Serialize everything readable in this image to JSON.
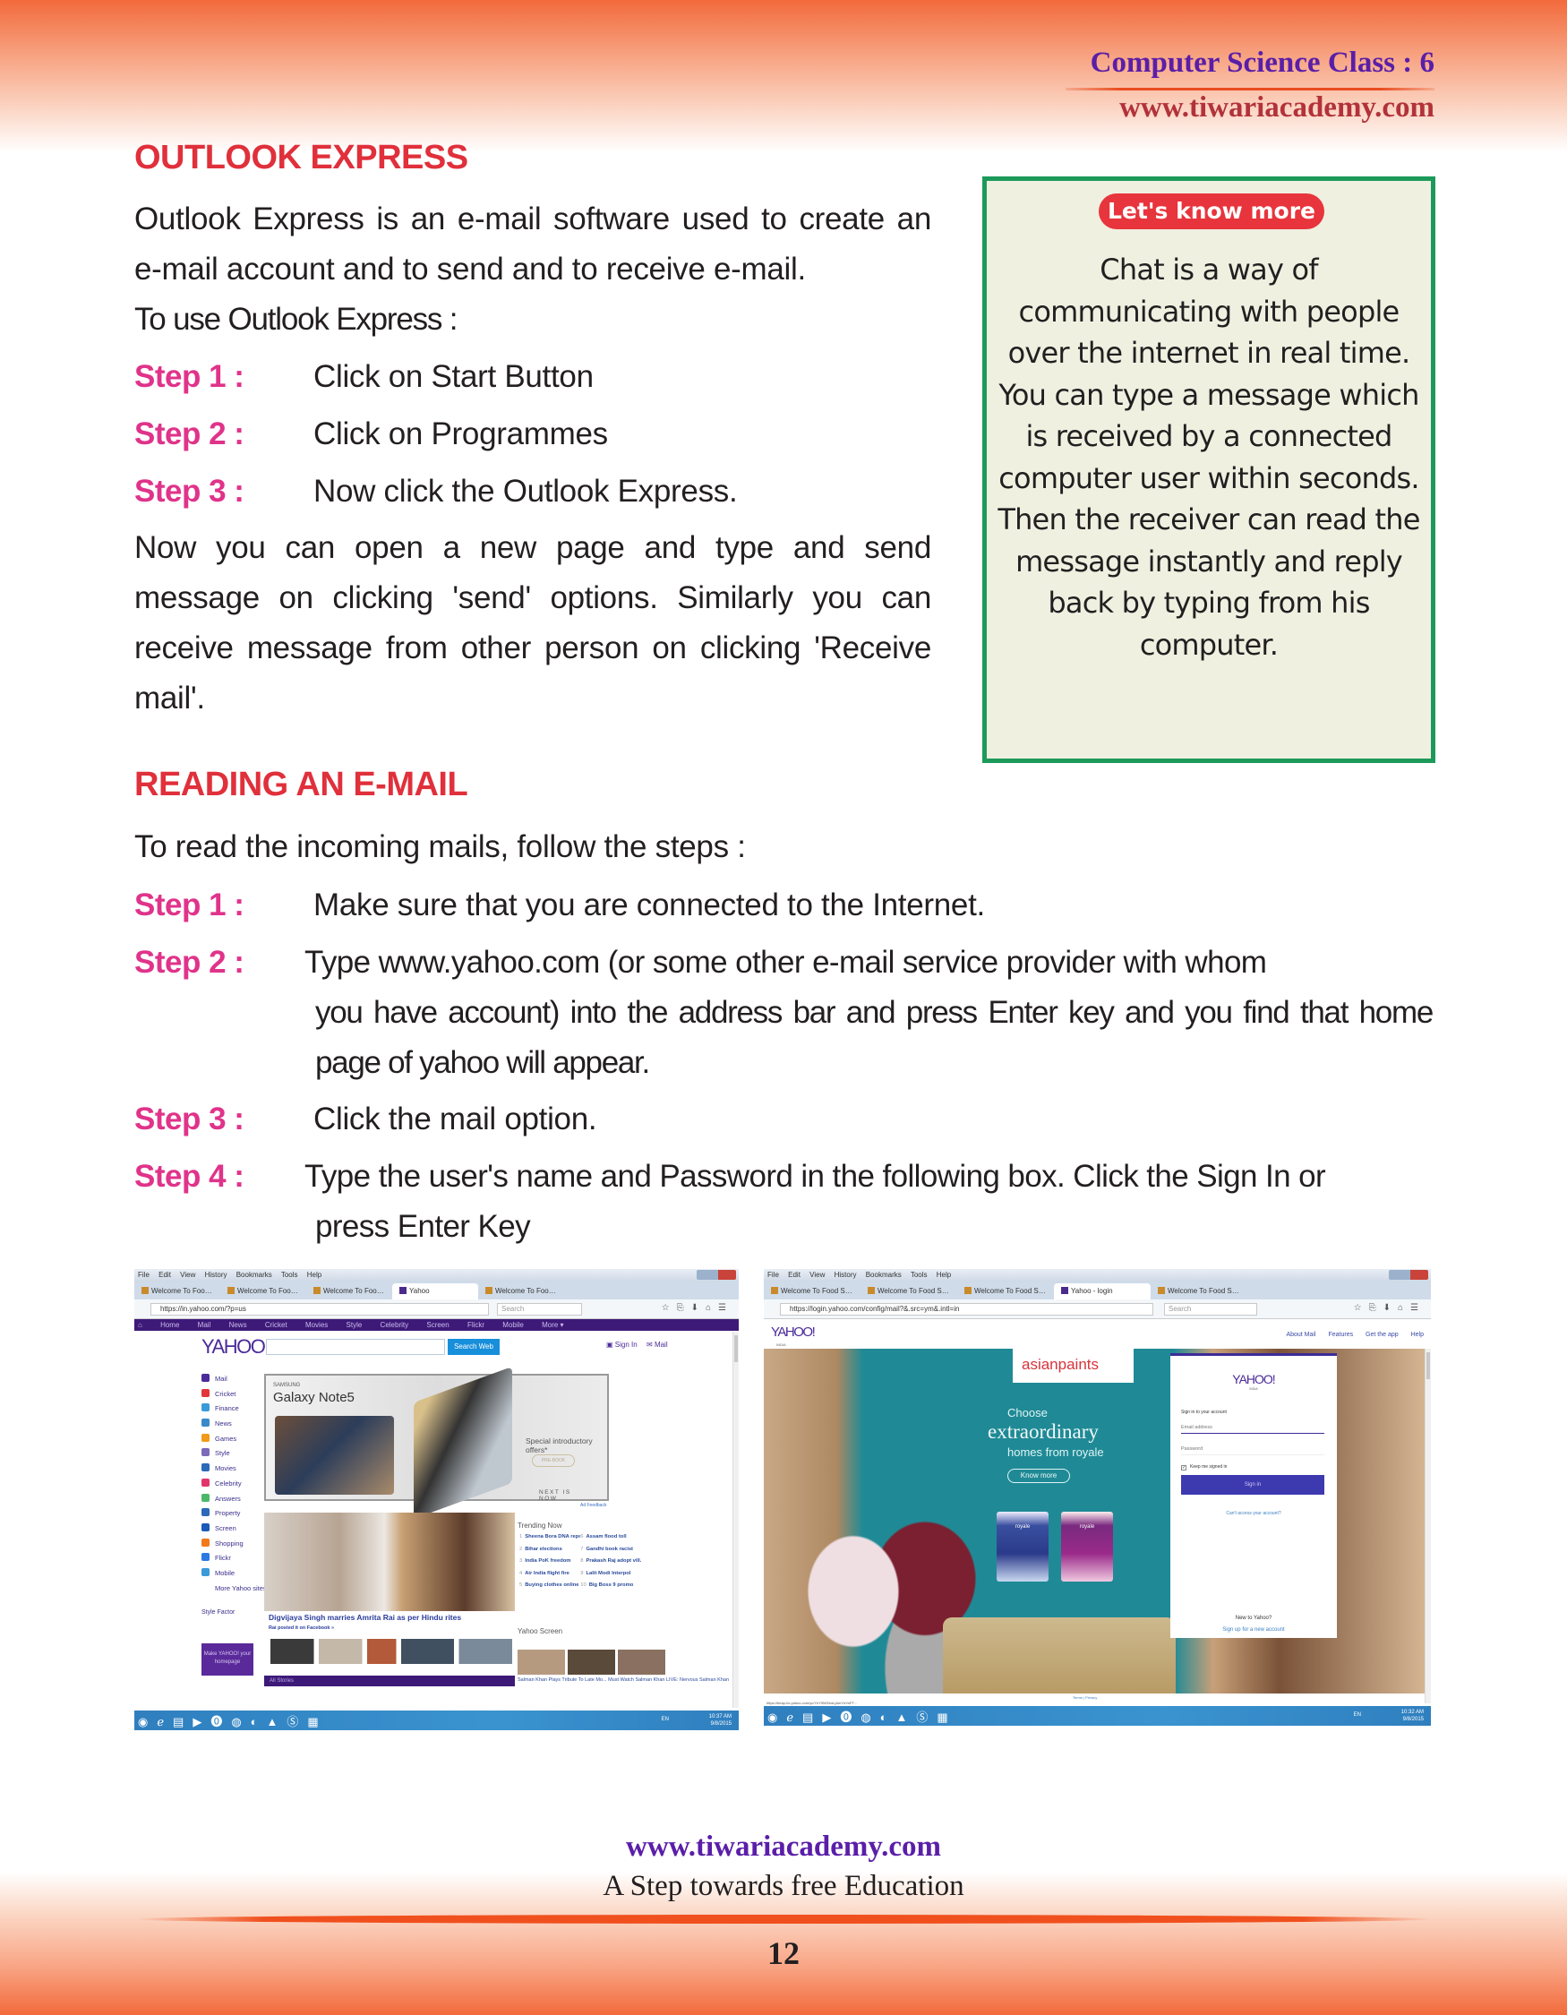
{
  "header": {
    "title": "Computer Science Class : 6",
    "url": "www.tiwariacademy.com"
  },
  "section1": {
    "heading": "OUTLOOK EXPRESS",
    "intro": "Outlook Express is an e-mail software used to create an e-mail account and to send and to receive e-mail.",
    "intro2": "To use Outlook Express :",
    "steps": [
      {
        "label": "Step 1 :",
        "text": "Click on Start Button"
      },
      {
        "label": "Step 2 :",
        "text": "Click on Programmes"
      },
      {
        "label": "Step 3 :",
        "text": "Now click the Outlook Express."
      }
    ],
    "outro": "Now you can open a new page and type and send message on clicking 'send' options. Similarly you can receive message from other person on clicking 'Receive mail'."
  },
  "know_more": {
    "badge": "Let's know more",
    "text": "Chat is a way of communicating with people over the internet in real time. You can type a message which is received by a connected computer user within seconds. Then the receiver can read the message instantly and reply back by typing from his computer."
  },
  "section2": {
    "heading": "READING AN E-MAIL",
    "intro": "To read the incoming mails, follow the steps :",
    "steps": [
      {
        "label": "Step 1 :",
        "text": "Make sure that you are connected to the Internet."
      },
      {
        "label": "Step 2 :",
        "text": "Type www.yahoo.com (or some other e-mail service provider with whom",
        "cont": "you have account) into the address bar and press Enter key and you find that home page of yahoo will appear."
      },
      {
        "label": "Step 3 :",
        "text": "Click the mail option."
      },
      {
        "label": "Step 4 :",
        "text": "Type the user's name and Password in the following box. Click the Sign In or",
        "cont": "press Enter Key"
      }
    ]
  },
  "screenshot_home": {
    "menu": [
      "File",
      "Edit",
      "View",
      "History",
      "Bookmarks",
      "Tools",
      "Help"
    ],
    "tabs": [
      "Welcome To Food Security...",
      "Welcome To Food Security...",
      "Welcome To Food Security...",
      "Yahoo",
      "Welcome To Food Security..."
    ],
    "active_tab": "Yahoo",
    "url": "https://in.yahoo.com/?p=us",
    "search_placeholder": "Search",
    "nav": [
      "Home",
      "Mail",
      "News",
      "Cricket",
      "Movies",
      "Style",
      "Celebrity",
      "Screen",
      "Flickr",
      "Mobile",
      "More ▾"
    ],
    "logo": "YAHOO!",
    "search_button": "Search Web",
    "sign_in": "Sign In",
    "mail": "Mail",
    "sidebar": [
      {
        "label": "Mail",
        "color": "#4b2a9a"
      },
      {
        "label": "Cricket",
        "color": "#e2363a"
      },
      {
        "label": "Finance",
        "color": "#3a9ad9"
      },
      {
        "label": "News",
        "color": "#3a8ac9"
      },
      {
        "label": "Games",
        "color": "#f29a1a"
      },
      {
        "label": "Style",
        "color": "#7a6ab8"
      },
      {
        "label": "Movies",
        "color": "#2a6ab8"
      },
      {
        "label": "Celebrity",
        "color": "#e2366a"
      },
      {
        "label": "Answers",
        "color": "#4ab86a"
      },
      {
        "label": "Property",
        "color": "#2a6ab8"
      },
      {
        "label": "Screen",
        "color": "#1a5ab8"
      },
      {
        "label": "Shopping",
        "color": "#f27a1a"
      },
      {
        "label": "Flickr",
        "color": "#2a7ae2"
      },
      {
        "label": "Mobile",
        "color": "#3a9ad9"
      },
      {
        "label": "More Yahoo sites »",
        "color": "#ffffff"
      }
    ],
    "style_factor": "Style Factor",
    "make_yahoo": "Make YAHOO! your homepage",
    "ad": {
      "brand": "SAMSUNG",
      "title": "Galaxy Note5",
      "offer": "Special introductory offers*",
      "cta": "PRE-BOOK",
      "tagline": "NEXT IS NOW",
      "feedback": "Ad Feedback"
    },
    "news_headline": "Digvijaya Singh marries Amrita Rai as per Hindu rites",
    "news_link": "Rai posted it on Facebook »",
    "trending_title": "Trending Now",
    "trending": [
      "Sheena Bora DNA report",
      "Bihar elections",
      "India PoK freedom",
      "Air India flight fire",
      "Buying clothes online",
      "Assam flood toll",
      "Gandhi book racist",
      "Prakash Raj adopt vill...",
      "Lalit Modi Interpol",
      "Big Boss 9 promo"
    ],
    "yahoo_screen_title": "Yahoo Screen",
    "yahoo_screen_captions": "Salman Khan Plays Tribute To Late Mo...   Must Watch Salman Khan   LIVE: Nervous Salman Khan",
    "all_stories": "All Stories",
    "language": "EN",
    "time": "10:37 AM",
    "date": "9/8/2015"
  },
  "screenshot_login": {
    "menu": [
      "File",
      "Edit",
      "View",
      "History",
      "Bookmarks",
      "Tools",
      "Help"
    ],
    "tabs": [
      "Welcome To Food Security...",
      "Welcome To Food Security...",
      "Welcome To Food Security...",
      "Yahoo - login",
      "Welcome To Food Security..."
    ],
    "url": "https://login.yahoo.com/config/mail?&.src=ym&.intl=in",
    "search_placeholder": "Search",
    "logo": "YAHOO!",
    "logo_sub": "INDIA",
    "links": [
      "About Mail",
      "Features",
      "Get the app",
      "Help"
    ],
    "ad": {
      "brand": "asianpaints",
      "line1": "Choose",
      "line2": "extraordinary",
      "line3": "homes from royale",
      "cta": "Know more",
      "product": "royale"
    },
    "card": {
      "prompt": "Sign in to your account",
      "email_placeholder": "Email address",
      "password_placeholder": "Password",
      "keep_signed_in": "Keep me signed in",
      "sign_in_button": "Sign in",
      "cant_access": "Can't access your account?",
      "new_to_yahoo": "New to Yahoo?",
      "sign_up": "Sign up for a new account"
    },
    "terms": "Terms | Privacy",
    "status_url": "https://beap-bc.yahoo.com/yc/YnY9MS4wLjAmYnVsPT...",
    "language": "EN",
    "time": "10:32 AM",
    "date": "9/8/2015"
  },
  "footer": {
    "url": "www.tiwariacademy.com",
    "tagline": "A Step towards free Education",
    "page_number": "12"
  }
}
